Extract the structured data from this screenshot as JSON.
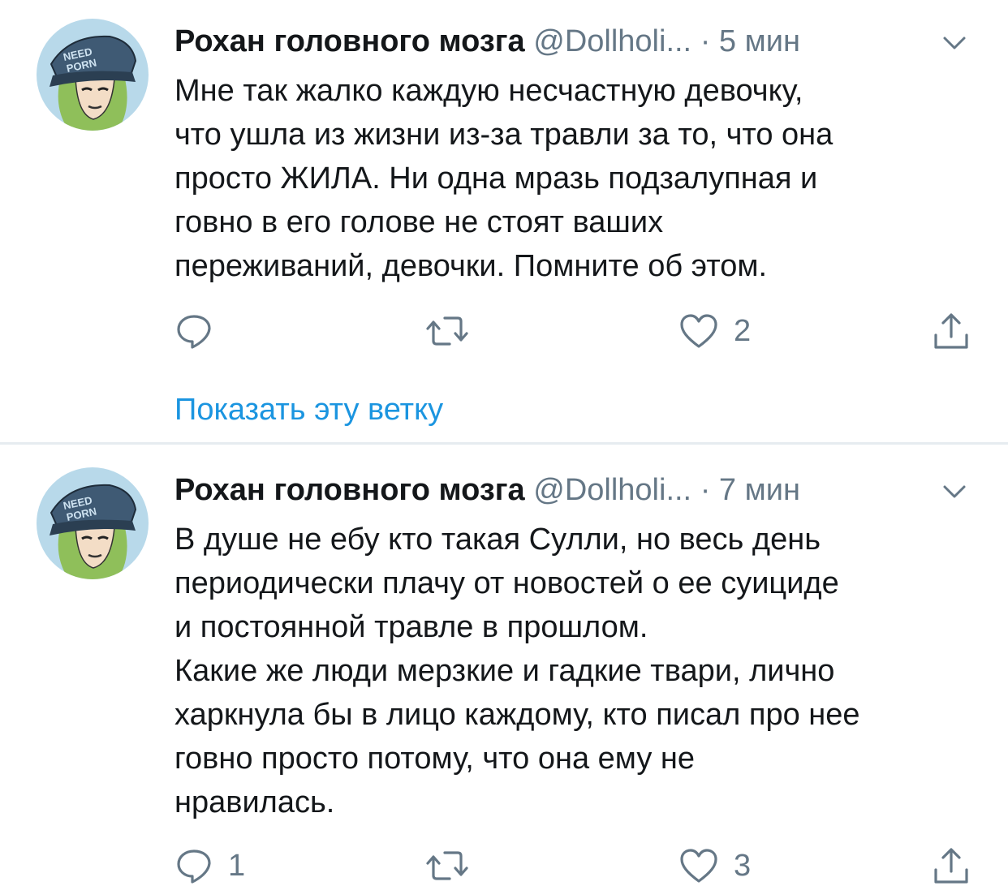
{
  "tweets": [
    {
      "author": "Рохан головного мозга",
      "handle": "@Dollholi...",
      "separator": "·",
      "time": "5 мин",
      "text_lines": [
        "Мне так жалко каждую несчастную девочку,",
        "что ушла из жизни из-за травли за то, что она",
        "просто ЖИЛА. Ни одна мразь подзалупная и",
        "говно в его голове не стоят ваших",
        "переживаний, девочки. Помните об этом."
      ],
      "actions": {
        "reply_count": "",
        "retweet_count": "",
        "like_count": "2"
      },
      "show_thread": "Показать эту ветку",
      "avatar_cap_text": [
        "NEED",
        "PORN"
      ]
    },
    {
      "author": "Рохан головного мозга",
      "handle": "@Dollholi...",
      "separator": "·",
      "time": "7 мин",
      "text_lines": [
        "В душе не ебу кто такая Сулли, но весь день",
        "периодически плачу от новостей о ее суициде",
        "и постоянной травле в прошлом.",
        "Какие же люди мерзкие и гадкие твари, лично",
        "харкнула бы в лицо каждому, кто писал про нее",
        "говно просто потому, что она ему не",
        "нравилась."
      ],
      "actions": {
        "reply_count": "1",
        "retweet_count": "",
        "like_count": "3"
      },
      "avatar_cap_text": [
        "NEED",
        "PORN"
      ]
    }
  ],
  "icons": {
    "reply": "reply-icon",
    "retweet": "retweet-icon",
    "like": "heart-icon",
    "share": "share-icon",
    "more": "chevron-down-icon"
  },
  "colors": {
    "text": "#14171a",
    "secondary": "#657786",
    "link": "#1b95e0",
    "divider": "#e6ecf0",
    "avatar_bg": "#b8d9ea",
    "cap": "#3f5a74",
    "hair": "#8fbf5a"
  }
}
